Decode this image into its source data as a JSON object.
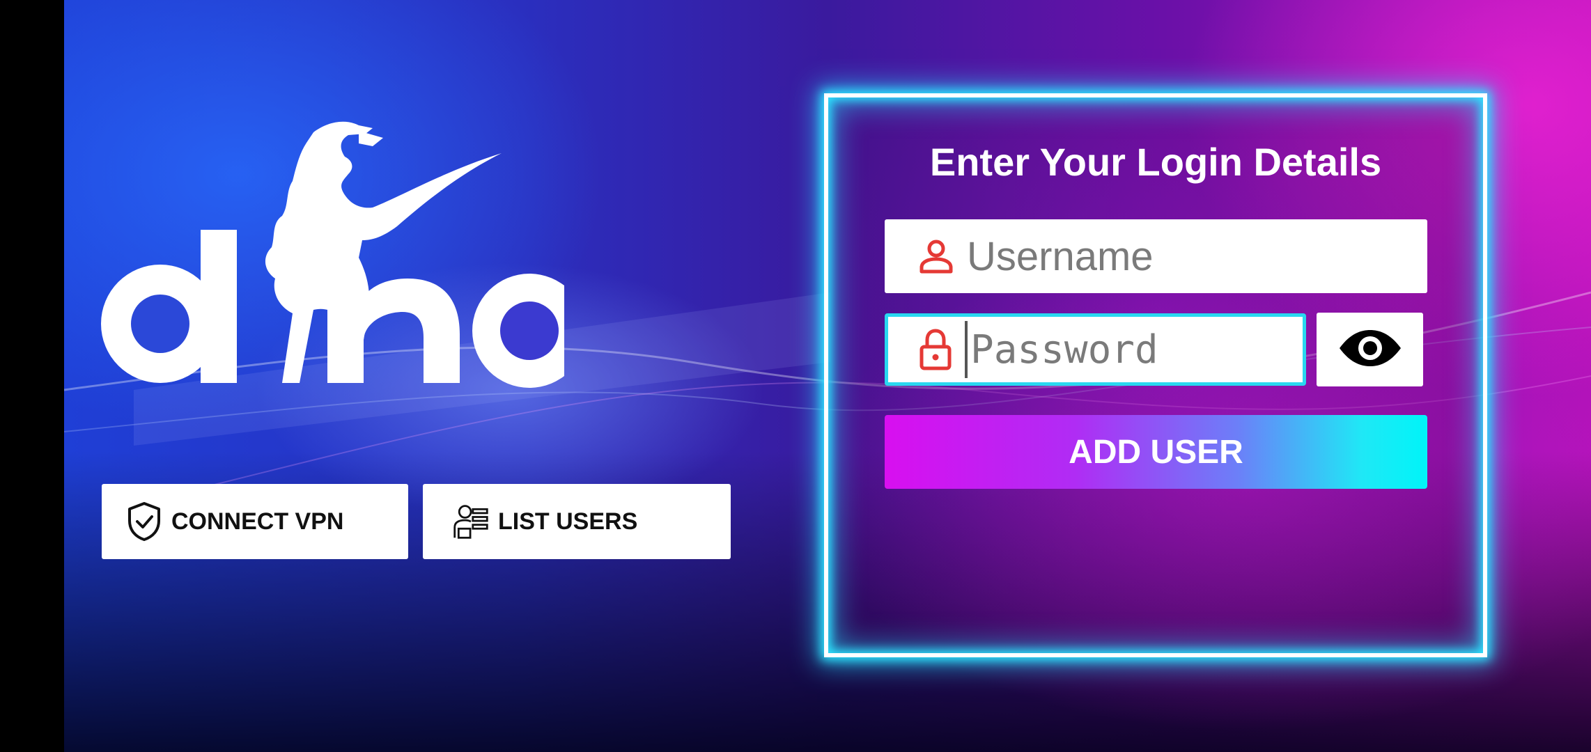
{
  "brand": {
    "logo_text": "dino"
  },
  "left_actions": {
    "connect_vpn_label": "CONNECT VPN",
    "list_users_label": "LIST USERS"
  },
  "login": {
    "title": "Enter Your Login Details",
    "username_placeholder": "Username",
    "password_placeholder": "Password",
    "add_user_label": "ADD USER"
  },
  "icons": {
    "vpn": "shield-check-icon",
    "list_users": "user-list-icon",
    "username": "person-icon",
    "password": "lock-icon",
    "toggle_visibility": "eye-icon"
  },
  "colors": {
    "icon_red": "#e53935",
    "panel_glow": "#2de6ff",
    "button_gradient_start": "#d80ff0",
    "button_gradient_end": "#00f4f8"
  }
}
